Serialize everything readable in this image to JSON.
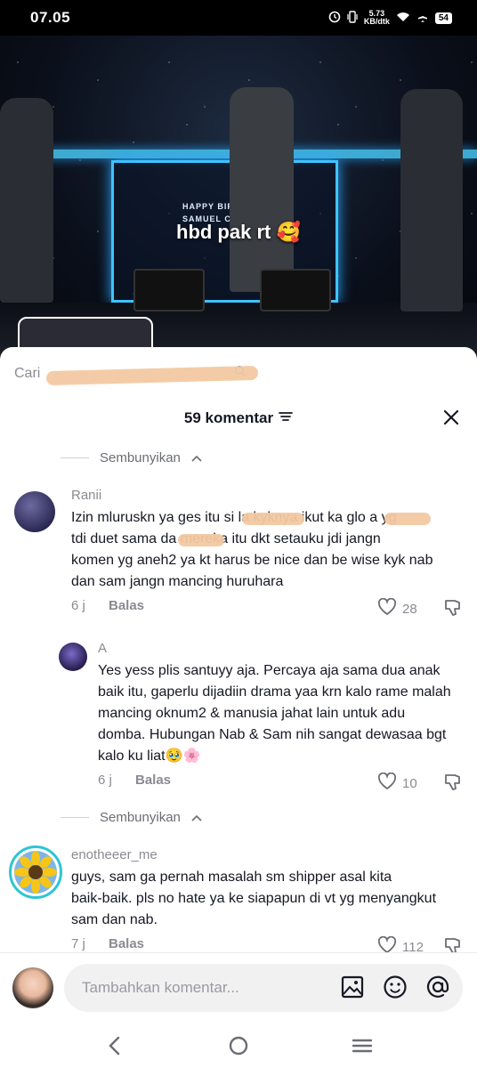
{
  "status": {
    "time": "07.05",
    "net_speed_value": "5.73",
    "net_speed_unit": "KB/dtk",
    "battery": "54"
  },
  "video": {
    "caption": "hbd pak rt 🥰",
    "screen_line1": "HAPPY BIRT",
    "screen_line2": "SAMUEL CI"
  },
  "search": {
    "text": "Cari"
  },
  "sheet": {
    "count_label": "59 komentar",
    "hide_label": "Sembunyikan"
  },
  "comments": [
    {
      "user": "Ranii",
      "text_lines": [
        "Izin mluruskn ya ges itu si          la kyknya ikut ka glo   a yg",
        "tdi duet sama da       mereka itu dkt setauku jdi jangn",
        "komen yg aneh2 ya kt harus be nice dan be wise kyk nab",
        "dan sam jangn mancing huruhara"
      ],
      "date": "6 j",
      "reply": "Balas",
      "likes": "28"
    },
    {
      "user": "A",
      "text_lines": [
        "Yes yess plis santuyy aja. Percaya aja sama dua anak",
        "baik itu, gaperlu dijadiin drama yaa krn kalo rame malah",
        "mancing oknum2 & manusia jahat lain untuk adu",
        "domba. Hubungan Nab & Sam nih sangat dewasaa bgt",
        "kalo ku liat🥹🌸"
      ],
      "date": "6 j",
      "reply": "Balas",
      "likes": "10"
    },
    {
      "user": "enotheeer_me",
      "text_lines": [
        "guys, sam ga pernah masalah sm shipper asal kita",
        "baik-baik. pls no hate ya ke siapapun di vt yg menyangkut",
        "sam dan nab."
      ],
      "date": "7 j",
      "reply": "Balas",
      "likes": "112"
    }
  ],
  "input": {
    "placeholder": "Tambahkan komentar..."
  },
  "colors": {
    "text": "#161823",
    "muted": "#8a8b91",
    "accent_glow": "#3fc3ff",
    "scribble": "#f2c9a2"
  }
}
